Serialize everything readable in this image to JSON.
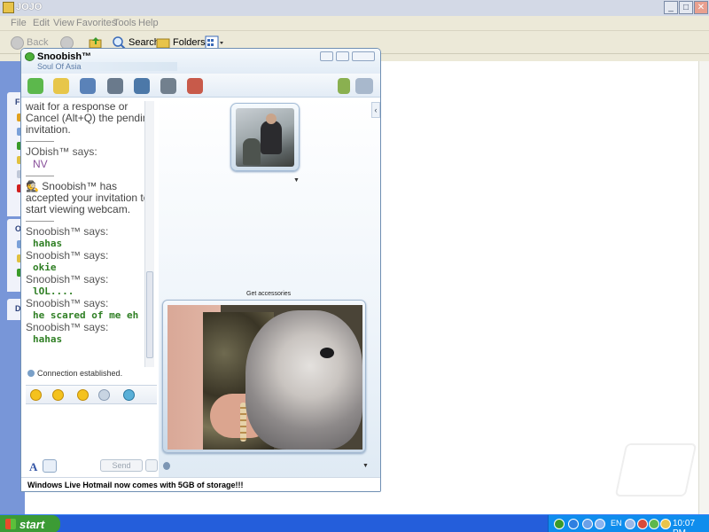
{
  "explorer": {
    "title": "JOJO",
    "menu": [
      "File",
      "Edit",
      "View",
      "Favorites",
      "Tools",
      "Help"
    ],
    "toolbar": {
      "back_label": "Back",
      "search_label": "Search",
      "folders_label": "Folders"
    },
    "sidebar_letters": [
      "Fi",
      "O",
      "D"
    ]
  },
  "messenger": {
    "contact": {
      "name": "Snoobish™",
      "personal_message": "Soul Of Asia"
    },
    "toolbar_icons": [
      "invite-contact-icon",
      "send-files-icon",
      "webcam-icon",
      "call-icon",
      "activities-icon",
      "games-icon",
      "block-icon",
      "theme-brush-icon",
      "options-icon"
    ],
    "conversation": [
      {
        "type": "system",
        "text": "wait for a response or Cancel (Alt+Q) the pending invitation."
      },
      {
        "type": "separator"
      },
      {
        "type": "says",
        "text": "JObish™ says:"
      },
      {
        "type": "reply_nv",
        "text": "NV"
      },
      {
        "type": "separator"
      },
      {
        "type": "system_icon",
        "text": "Snoobish™ has accepted your invitation to start viewing webcam."
      },
      {
        "type": "separator"
      },
      {
        "type": "says",
        "text": "Snoobish™ says:"
      },
      {
        "type": "reply",
        "text": "hahas"
      },
      {
        "type": "says",
        "text": "Snoobish™ says:"
      },
      {
        "type": "reply",
        "text": "okie"
      },
      {
        "type": "says",
        "text": "Snoobish™ says:"
      },
      {
        "type": "reply",
        "text": "lOL...."
      },
      {
        "type": "says",
        "text": "Snoobish™ says:"
      },
      {
        "type": "reply",
        "text": "he scared of me eh"
      },
      {
        "type": "says",
        "text": "Snoobish™ says:"
      },
      {
        "type": "reply",
        "text": "hahas"
      }
    ],
    "status_text": "Connection established.",
    "send_label": "Send",
    "font_label": "A",
    "get_accessories": "Get accessories",
    "ad_text": "Windows Live Hotmail now comes with 5GB of storage!!!"
  },
  "taskbar": {
    "start_label": "start",
    "language": "EN",
    "clock": "10:07 PM"
  },
  "colors": {
    "taskbar_blue": "#245edb",
    "start_green": "#3c9b35",
    "reply_green": "#2f7f24",
    "msn_border": "#6f8fb3"
  }
}
